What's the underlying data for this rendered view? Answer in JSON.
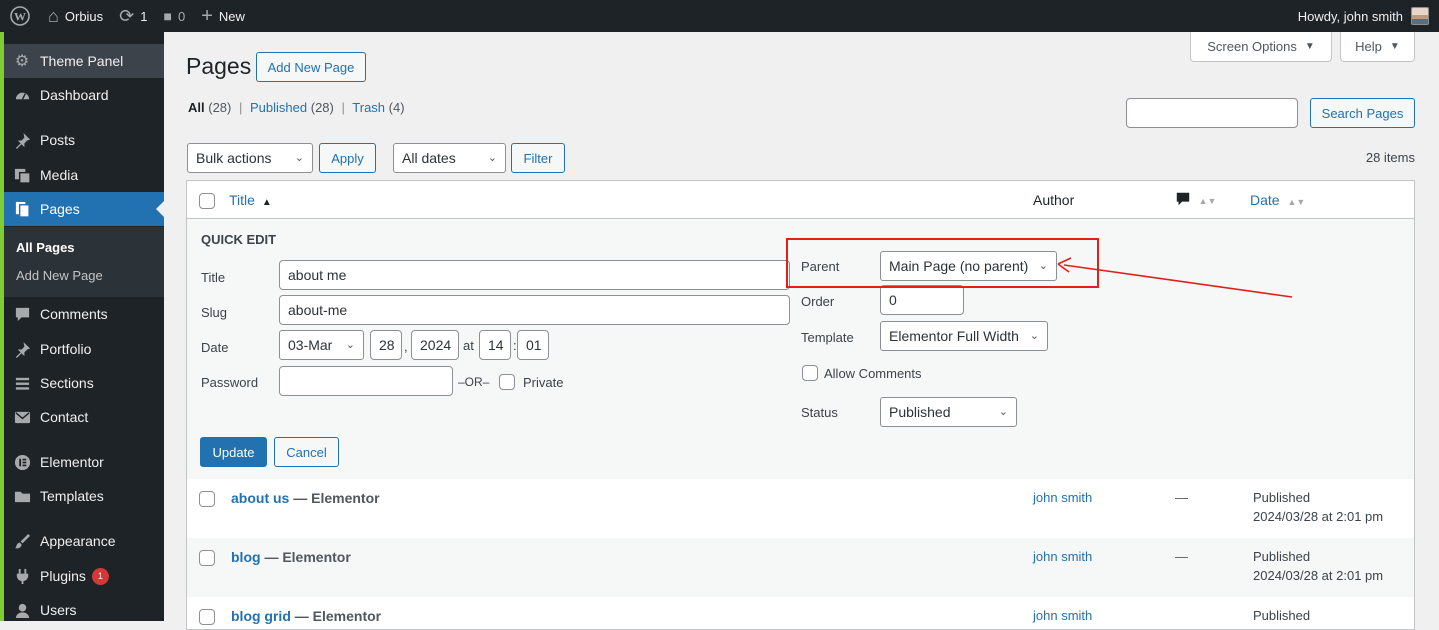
{
  "admin_bar": {
    "site_name": "Orbius",
    "updates_count": "1",
    "comments_count": "0",
    "new_label": "New",
    "greeting": "Howdy, john smith"
  },
  "sidebar": {
    "items": [
      {
        "label": "Theme Panel",
        "icon": "gear-icon"
      },
      {
        "label": "Dashboard",
        "icon": "dashboard-icon"
      },
      {
        "label": "Posts",
        "icon": "pushpin-icon"
      },
      {
        "label": "Media",
        "icon": "media-icon"
      },
      {
        "label": "Pages",
        "icon": "pages-icon"
      },
      {
        "label": "Comments",
        "icon": "comment-icon"
      },
      {
        "label": "Portfolio",
        "icon": "pushpin-icon"
      },
      {
        "label": "Sections",
        "icon": "sections-icon"
      },
      {
        "label": "Contact",
        "icon": "mail-icon"
      },
      {
        "label": "Elementor",
        "icon": "elementor-icon"
      },
      {
        "label": "Templates",
        "icon": "folder-icon"
      },
      {
        "label": "Appearance",
        "icon": "brush-icon"
      },
      {
        "label": "Plugins",
        "icon": "plugin-icon",
        "badge": "1"
      },
      {
        "label": "Users",
        "icon": "users-icon"
      }
    ],
    "submenu": [
      "All Pages",
      "Add New Page"
    ]
  },
  "header": {
    "title": "Pages",
    "add_new": "Add New Page",
    "screen_options": "Screen Options",
    "help": "Help"
  },
  "filters": {
    "all": "All",
    "all_count": "(28)",
    "published": "Published",
    "published_count": "(28)",
    "trash": "Trash",
    "trash_count": "(4)",
    "sep": "|",
    "search_button": "Search Pages",
    "bulk_actions": "Bulk actions",
    "apply": "Apply",
    "all_dates": "All dates",
    "filter": "Filter",
    "items_count": "28 items"
  },
  "table": {
    "col_title": "Title",
    "col_author": "Author",
    "col_date": "Date"
  },
  "quick_edit": {
    "heading": "QUICK EDIT",
    "title_label": "Title",
    "title_value": "about me",
    "slug_label": "Slug",
    "slug_value": "about-me",
    "date_label": "Date",
    "month": "03-Mar",
    "day": "28",
    "comma": ",",
    "year": "2024",
    "at": "at",
    "hour": "14",
    "colon": ":",
    "minute": "01",
    "password_label": "Password",
    "or": "–OR–",
    "private_label": "Private",
    "parent_label": "Parent",
    "parent_value": "Main Page (no parent)",
    "order_label": "Order",
    "order_value": "0",
    "template_label": "Template",
    "template_value": "Elementor Full Width",
    "allow_comments": "Allow Comments",
    "status_label": "Status",
    "status_value": "Published",
    "update": "Update",
    "cancel": "Cancel"
  },
  "rows": [
    {
      "title": "about us",
      "suffix": "— Elementor",
      "author": "john smith",
      "comments": "—",
      "status": "Published",
      "date": "2024/03/28 at 2:01 pm"
    },
    {
      "title": "blog",
      "suffix": "— Elementor",
      "author": "john smith",
      "comments": "—",
      "status": "Published",
      "date": "2024/03/28 at 2:01 pm"
    },
    {
      "title": "blog grid",
      "suffix": "— Elementor",
      "author": "john smith",
      "comments": "—",
      "status": "Published",
      "date": ""
    }
  ],
  "colors": {
    "accent": "#2271b1",
    "annotation": "#e0201b",
    "sidebar_bg": "#1d2327"
  }
}
